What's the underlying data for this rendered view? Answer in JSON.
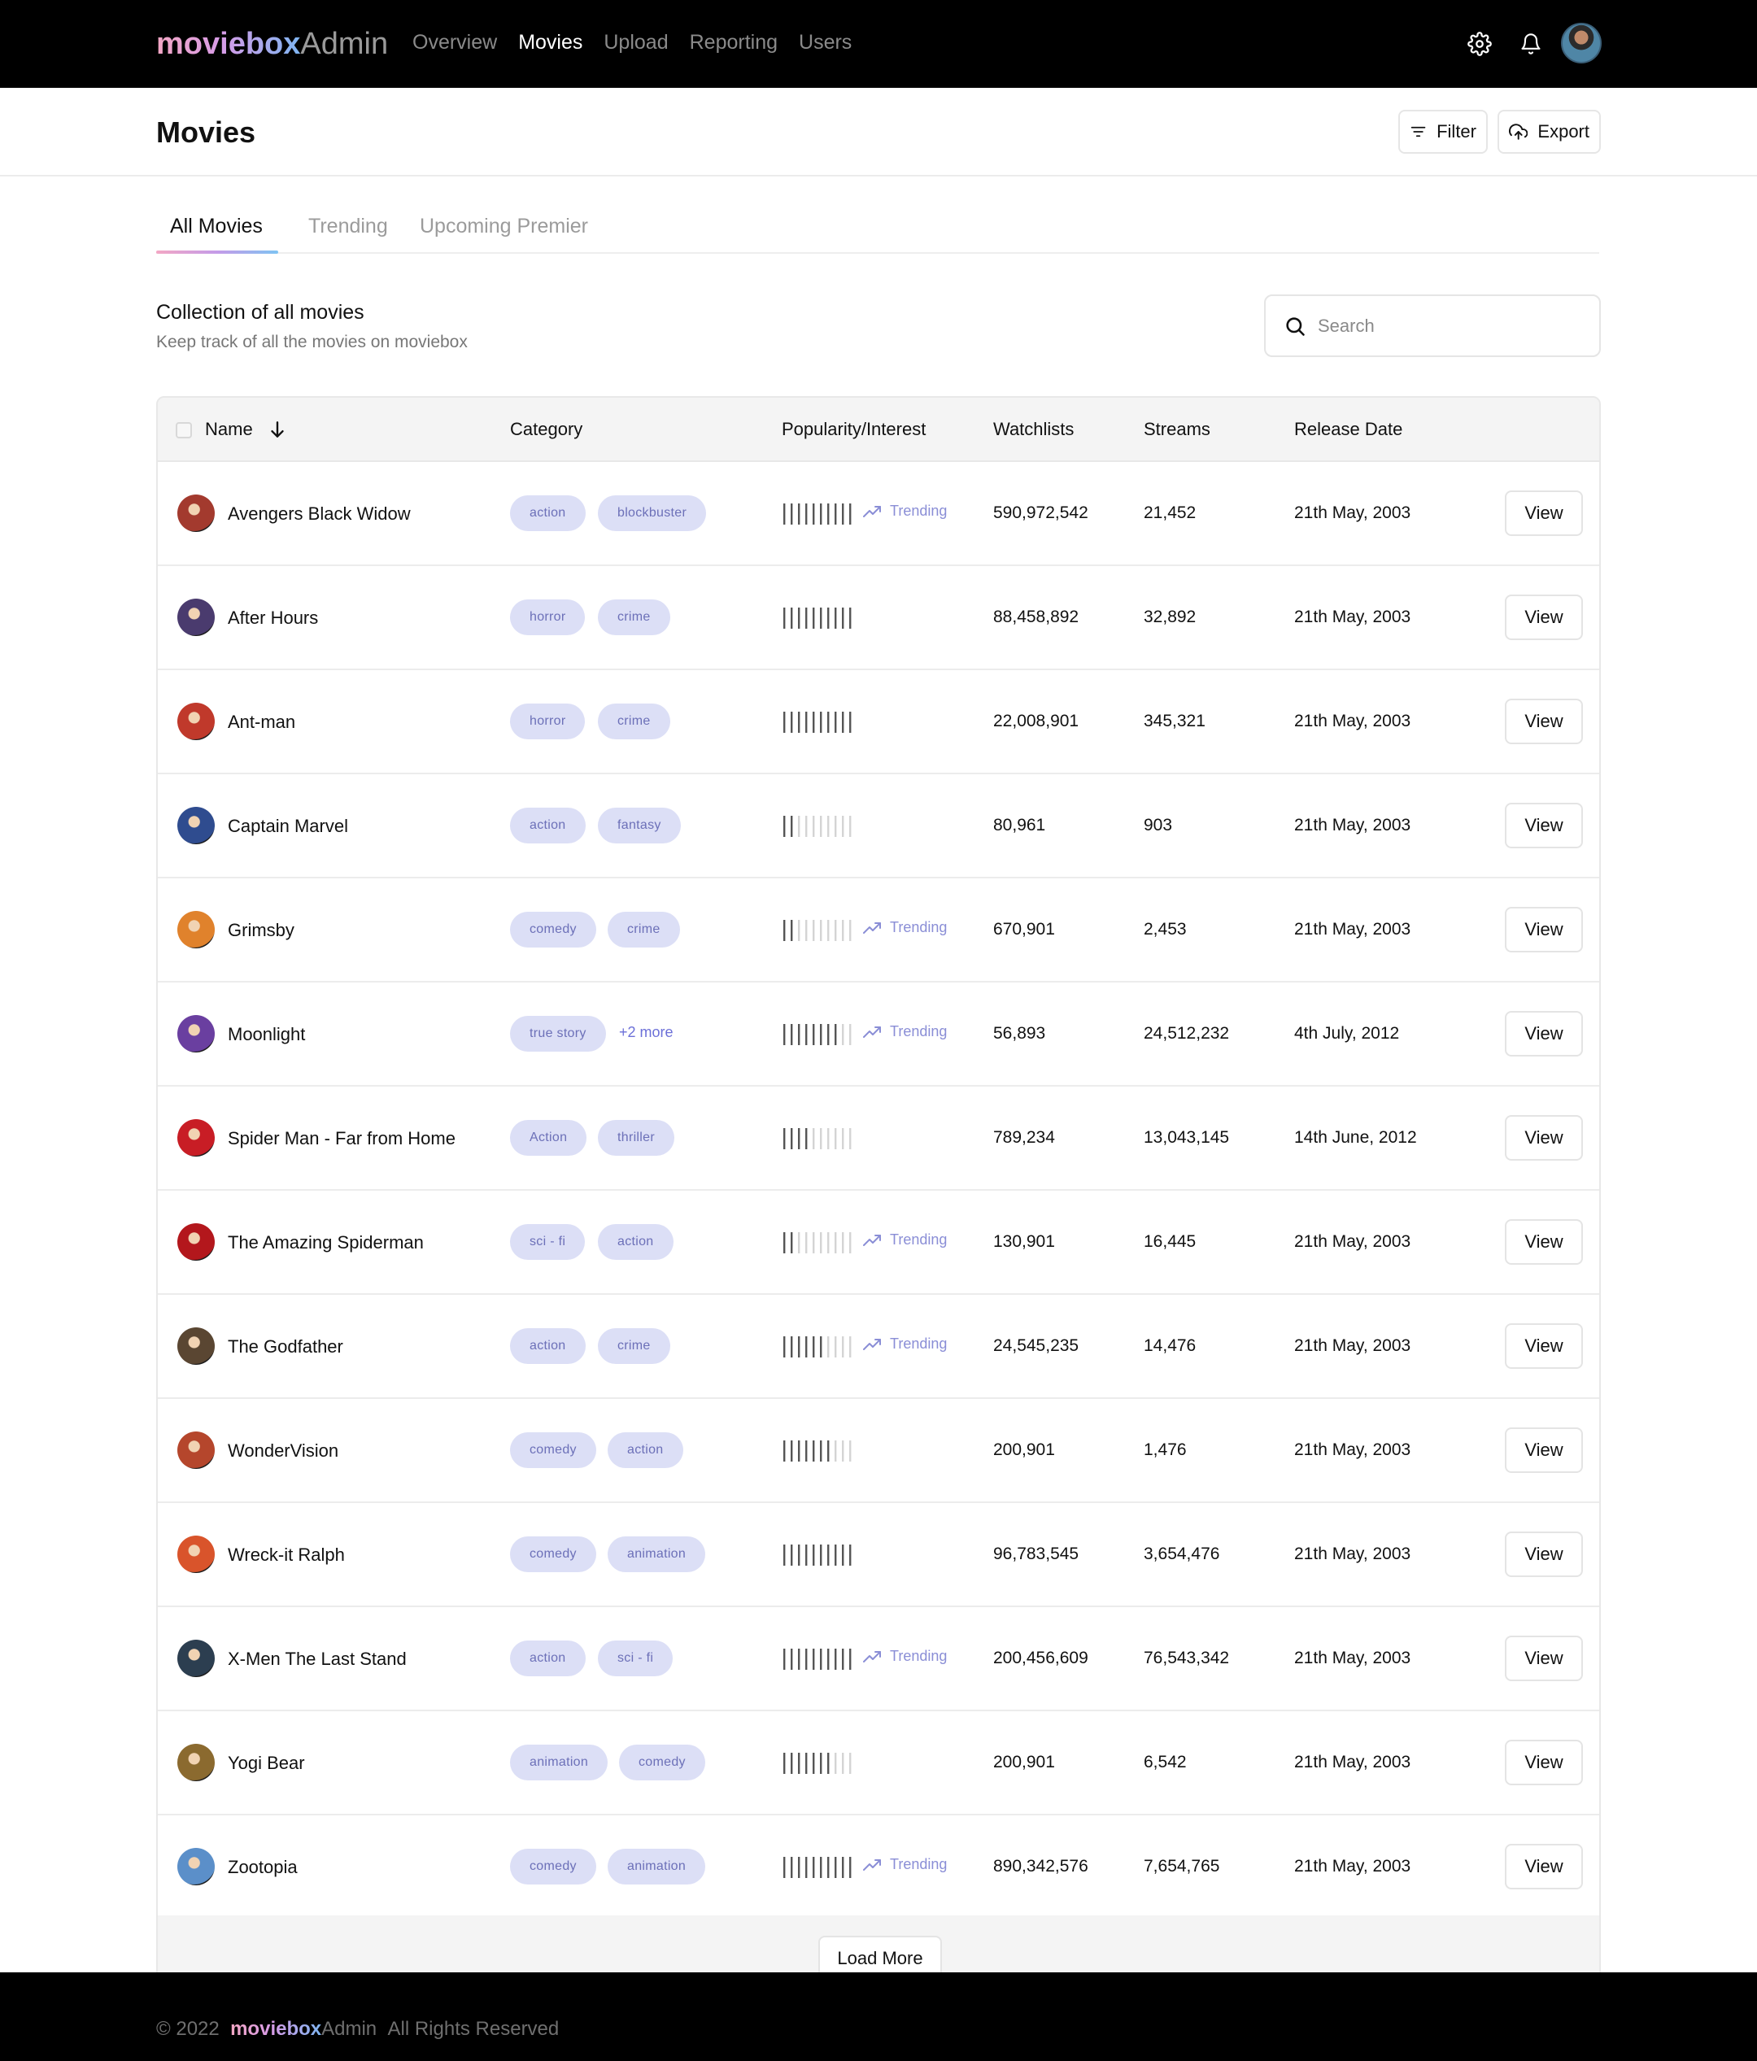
{
  "brand": {
    "part1": "moviebox",
    "part2": "Admin"
  },
  "nav": {
    "links": [
      "Overview",
      "Movies",
      "Upload",
      "Reporting",
      "Users"
    ],
    "active": "Movies",
    "icons": [
      "gear-icon",
      "bell-icon"
    ]
  },
  "page": {
    "title": "Movies",
    "filter_label": "Filter",
    "export_label": "Export"
  },
  "tabs": [
    "All Movies",
    "Trending",
    "Upcoming Premier"
  ],
  "section": {
    "title": "Collection of all movies",
    "subtitle": "Keep track of all the movies on moviebox"
  },
  "search": {
    "placeholder": "Search",
    "value": ""
  },
  "table": {
    "columns": [
      "Name",
      "Category",
      "Popularity/Interest",
      "Watchlists",
      "Streams",
      "Release Date"
    ],
    "sort": {
      "column": "Name",
      "direction": "descending"
    },
    "view_label": "View",
    "trending_label": "Trending",
    "rows": [
      {
        "name": "Avengers Black Widow",
        "tags": [
          "action",
          "blockbuster"
        ],
        "more": "",
        "popularity": 10,
        "trending": true,
        "watchlists": "590,972,542",
        "streams": "21,452",
        "release": "21th May, 2003",
        "color": "#a33a2e"
      },
      {
        "name": "After Hours",
        "tags": [
          "horror",
          "crime"
        ],
        "more": "",
        "popularity": 10,
        "trending": false,
        "watchlists": "88,458,892",
        "streams": "32,892",
        "release": "21th May, 2003",
        "color": "#4a3b6e"
      },
      {
        "name": "Ant-man",
        "tags": [
          "horror",
          "crime"
        ],
        "more": "",
        "popularity": 10,
        "trending": false,
        "watchlists": "22,008,901",
        "streams": "345,321",
        "release": "21th May, 2003",
        "color": "#c0392b"
      },
      {
        "name": "Captain Marvel",
        "tags": [
          "action",
          "fantasy"
        ],
        "more": "",
        "popularity": 2,
        "trending": false,
        "watchlists": "80,961",
        "streams": "903",
        "release": "21th May, 2003",
        "color": "#2f4c8f"
      },
      {
        "name": "Grimsby",
        "tags": [
          "comedy",
          "crime"
        ],
        "more": "",
        "popularity": 2,
        "trending": true,
        "watchlists": "670,901",
        "streams": "2,453",
        "release": "21th May, 2003",
        "color": "#e0822c"
      },
      {
        "name": "Moonlight",
        "tags": [
          "true story"
        ],
        "more": "+2 more",
        "popularity": 8,
        "trending": true,
        "watchlists": "56,893",
        "streams": "24,512,232",
        "release": "4th July, 2012",
        "color": "#6a3fa0"
      },
      {
        "name": "Spider Man - Far from Home",
        "tags": [
          "Action",
          "thriller"
        ],
        "more": "",
        "popularity": 4,
        "trending": false,
        "watchlists": "789,234",
        "streams": "13,043,145",
        "release": "14th June, 2012",
        "color": "#c81d25"
      },
      {
        "name": "The Amazing Spiderman",
        "tags": [
          "sci - fi",
          "action"
        ],
        "more": "",
        "popularity": 2,
        "trending": true,
        "watchlists": "130,901",
        "streams": "16,445",
        "release": "21th May, 2003",
        "color": "#b3171c"
      },
      {
        "name": "The Godfather",
        "tags": [
          "action",
          "crime"
        ],
        "more": "",
        "popularity": 6,
        "trending": true,
        "watchlists": "24,545,235",
        "streams": "14,476",
        "release": "21th May, 2003",
        "color": "#5a4632"
      },
      {
        "name": "WonderVision",
        "tags": [
          "comedy",
          "action"
        ],
        "more": "",
        "popularity": 7,
        "trending": false,
        "watchlists": "200,901",
        "streams": "1,476",
        "release": "21th May, 2003",
        "color": "#b5462c"
      },
      {
        "name": "Wreck-it Ralph",
        "tags": [
          "comedy",
          "animation"
        ],
        "more": "",
        "popularity": 10,
        "trending": false,
        "watchlists": "96,783,545",
        "streams": "3,654,476",
        "release": "21th May, 2003",
        "color": "#d9542b"
      },
      {
        "name": "X-Men The Last Stand",
        "tags": [
          "action",
          "sci - fi"
        ],
        "more": "",
        "popularity": 10,
        "trending": true,
        "watchlists": "200,456,609",
        "streams": "76,543,342",
        "release": "21th May, 2003",
        "color": "#2c3e50"
      },
      {
        "name": "Yogi Bear",
        "tags": [
          "animation",
          "comedy"
        ],
        "more": "",
        "popularity": 7,
        "trending": false,
        "watchlists": "200,901",
        "streams": "6,542",
        "release": "21th May, 2003",
        "color": "#8b6a2f"
      },
      {
        "name": "Zootopia",
        "tags": [
          "comedy",
          "animation"
        ],
        "more": "",
        "popularity": 10,
        "trending": true,
        "watchlists": "890,342,576",
        "streams": "7,654,765",
        "release": "21th May, 2003",
        "color": "#5b8fc9"
      }
    ],
    "load_more_label": "Load More"
  },
  "footer": {
    "copyright": "© 2022",
    "brand1": "moviebox",
    "brand2": "Admin",
    "rights": "All Rights Reserved"
  }
}
